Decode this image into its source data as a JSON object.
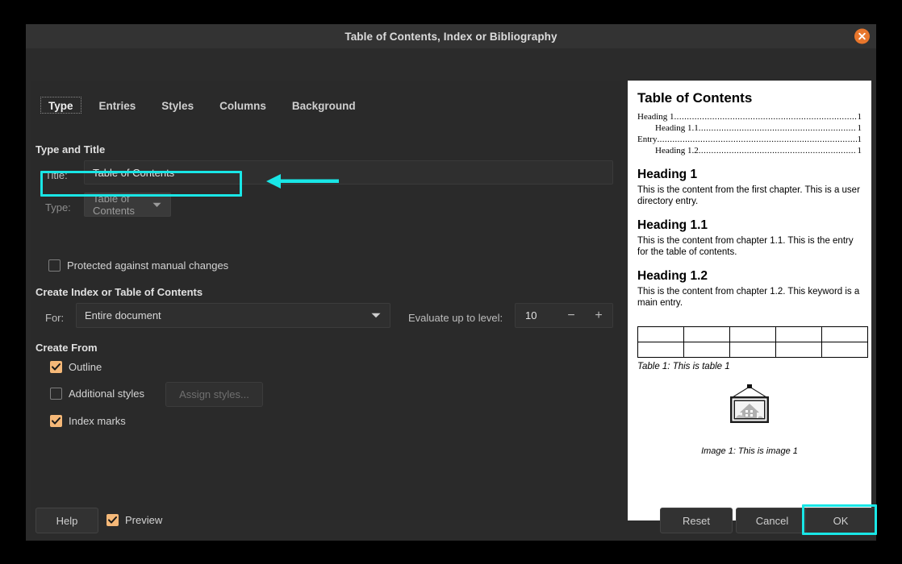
{
  "window": {
    "title": "Table of Contents, Index or Bibliography",
    "close_icon": "close-x-icon"
  },
  "tabs": [
    {
      "label": "Type",
      "active": true
    },
    {
      "label": "Entries",
      "active": false
    },
    {
      "label": "Styles",
      "active": false
    },
    {
      "label": "Columns",
      "active": false
    },
    {
      "label": "Background",
      "active": false
    }
  ],
  "type_tab": {
    "section_type_and_title": "Type and Title",
    "title_label": "Title:",
    "title_value": "Table of Contents",
    "type_label": "Type:",
    "type_value": "Table of Contents",
    "protected_label": "Protected against manual changes",
    "protected_checked": false,
    "section_create_index": "Create Index or Table of Contents",
    "for_label": "For:",
    "for_value": "Entire document",
    "evaluate_label": "Evaluate up to level:",
    "evaluate_value": "10",
    "evaluate_minus": "−",
    "evaluate_plus": "+",
    "section_create_from": "Create From",
    "outline_label": "Outline",
    "outline_checked": true,
    "additional_styles_label": "Additional styles",
    "additional_styles_checked": false,
    "assign_styles_label": "Assign styles...",
    "index_marks_label": "Index marks",
    "index_marks_checked": true
  },
  "preview": {
    "toc_title": "Table of Contents",
    "toc_entries": [
      {
        "text": "Heading  1",
        "level": 1,
        "page": "1"
      },
      {
        "text": "Heading 1.1",
        "level": 2,
        "page": "1"
      },
      {
        "text": "Entry",
        "level": 1,
        "page": "1"
      },
      {
        "text": "Heading 1.2",
        "level": 2,
        "page": "1"
      }
    ],
    "blocks": [
      {
        "heading": "Heading 1",
        "text": "This is the content from the first chapter. This is a user directory entry."
      },
      {
        "heading": "Heading 1.1",
        "text": "This is the content from chapter 1.1. This is the entry for the table of contents."
      },
      {
        "heading": "Heading 1.2",
        "text": "This is the content from chapter 1.2. This keyword is a main entry."
      }
    ],
    "table_caption": "Table 1: This is table 1",
    "table_cols": 5,
    "table_rows": 2,
    "image_icon": "framed-picture-icon",
    "image_caption": "Image 1: This is image 1"
  },
  "footer": {
    "help_label": "Help",
    "preview_label": "Preview",
    "preview_checked": true,
    "reset_label": "Reset",
    "cancel_label": "Cancel",
    "ok_label": "OK"
  },
  "annotations": {
    "highlight_color": "#19e6e6",
    "accent_color": "#f0a860",
    "close_color": "#e8762c",
    "targets": [
      "protected-against-manual-changes-checkbox",
      "ok-button"
    ],
    "arrow_direction": "left"
  }
}
